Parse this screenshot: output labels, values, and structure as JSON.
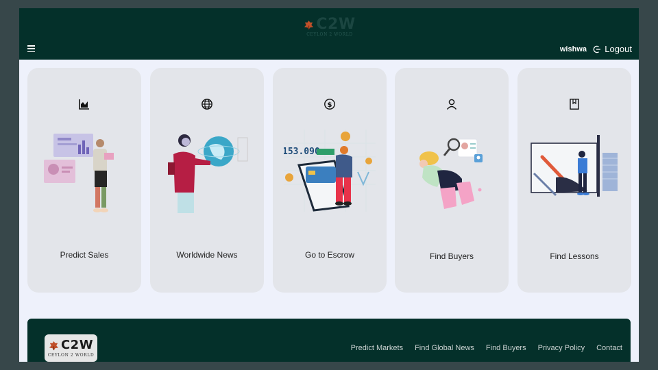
{
  "header": {
    "brand": "C2W",
    "brand_subtitle": "CEYLON 2 WORLD",
    "username": "wishwa",
    "logout_label": "Logout"
  },
  "cards": [
    {
      "label": "Predict Sales",
      "icon": "chart-icon"
    },
    {
      "label": "Worldwide News",
      "icon": "globe-icon"
    },
    {
      "label": "Go to Escrow",
      "icon": "dollar-icon"
    },
    {
      "label": "Find Buyers",
      "icon": "user-icon"
    },
    {
      "label": "Find Lessons",
      "icon": "book-icon"
    }
  ],
  "illustrations": {
    "escrow_number": "153.090"
  },
  "footer": {
    "brand": "C2W",
    "brand_subtitle": "CEYLON 2 WORLD",
    "links": [
      "Predict Markets",
      "Find Global News",
      "Find Buyers",
      "Privacy Policy",
      "Contact"
    ]
  },
  "colors": {
    "header_bg": "#04302a",
    "page_bg": "#eef1fb",
    "card_bg": "#e3e5ea",
    "outer_bg": "#37474a",
    "accent_orange": "#c0502a"
  }
}
